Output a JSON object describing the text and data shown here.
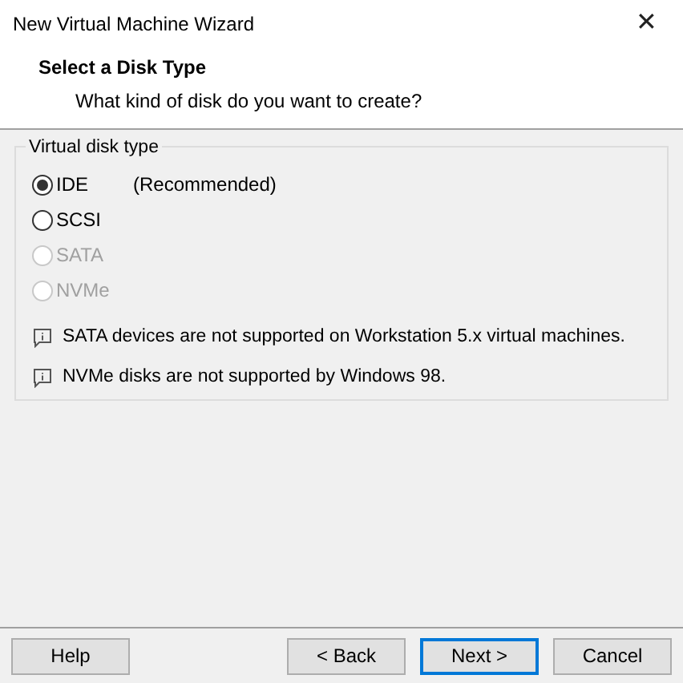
{
  "window": {
    "title": "New Virtual Machine Wizard",
    "close": "✕"
  },
  "header": {
    "title": "Select a Disk Type",
    "subtitle": "What kind of disk do you want to create?"
  },
  "group": {
    "label": "Virtual disk type",
    "options": [
      {
        "label": "IDE",
        "note": "(Recommended)",
        "selected": true,
        "disabled": false
      },
      {
        "label": "SCSI",
        "selected": false,
        "disabled": false
      },
      {
        "label": "SATA",
        "selected": false,
        "disabled": true
      },
      {
        "label": "NVMe",
        "selected": false,
        "disabled": true
      }
    ],
    "notes": [
      "SATA devices are not supported on Workstation 5.x virtual machines.",
      "NVMe disks are not supported by Windows 98."
    ]
  },
  "buttons": [
    {
      "label": "Help",
      "default": false
    },
    {
      "label": "< Back",
      "default": false
    },
    {
      "label": "Next >",
      "default": true
    },
    {
      "label": "Cancel",
      "default": false
    }
  ]
}
